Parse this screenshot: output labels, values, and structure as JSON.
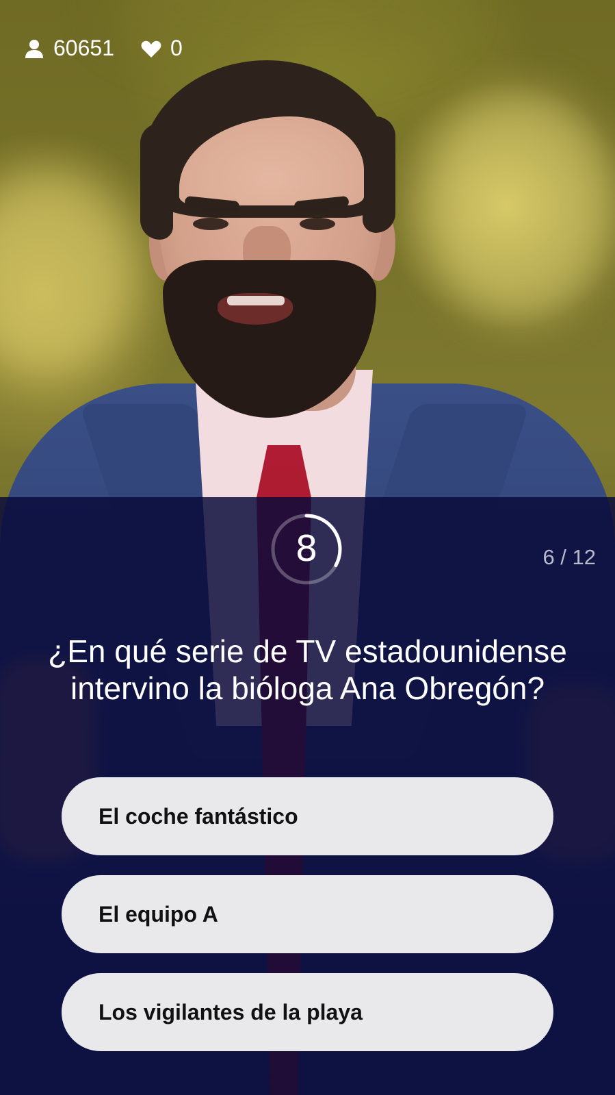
{
  "stats": {
    "players_icon": "user-icon",
    "players_count": "60651",
    "lives_icon": "heart-icon",
    "lives_count": "0"
  },
  "timer": {
    "seconds": "8",
    "progress": 0.33
  },
  "question": {
    "counter": "6 / 12",
    "text": "¿En qué serie de TV estadounidense intervino la bióloga Ana Obregón?"
  },
  "answers": [
    {
      "label": "El coche fantástico"
    },
    {
      "label": "El equipo A"
    },
    {
      "label": "Los vigilantes de la playa"
    }
  ],
  "colors": {
    "overlay": "#0a0b3a",
    "answer_bg": "#e9e9ec",
    "answer_text": "#111111",
    "counter_text": "#b9bacd"
  }
}
